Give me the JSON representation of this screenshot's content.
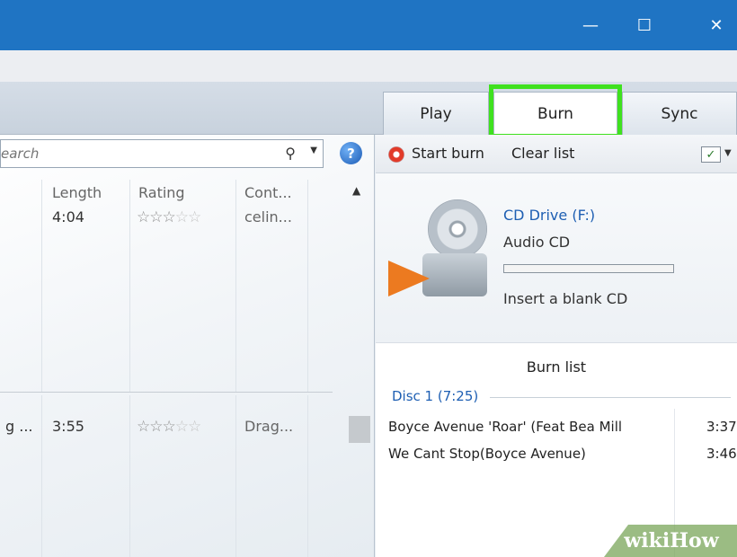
{
  "window": {
    "controls": {
      "minimize": "—",
      "maximize": "☐",
      "close": "✕"
    }
  },
  "tabs": [
    {
      "label": "Play",
      "active": false
    },
    {
      "label": "Burn",
      "active": true
    },
    {
      "label": "Sync",
      "active": false
    }
  ],
  "search": {
    "value": "",
    "placeholder": "earch"
  },
  "library": {
    "columns": [
      "Length",
      "Rating",
      "Cont..."
    ],
    "rows": [
      {
        "title": "",
        "length": "4:04",
        "rating": 3,
        "contributing": "celin..."
      },
      {
        "title": "g ...",
        "length": "3:55",
        "rating": 3,
        "contributing": "Drag..."
      }
    ]
  },
  "burn_toolbar": {
    "start_burn": "Start burn",
    "clear_list": "Clear list"
  },
  "drive": {
    "name": "CD Drive (F:)",
    "media": "Audio CD",
    "status": "Insert a blank CD",
    "progress": 0
  },
  "burn_list": {
    "title": "Burn list",
    "disc": "Disc 1 (7:25)",
    "tracks": [
      {
        "title": "Boyce Avenue  'Roar' (Feat Bea Mill",
        "time": "3:37"
      },
      {
        "title": "We Cant Stop(Boyce Avenue)",
        "time": "3:46"
      }
    ]
  },
  "watermark": "wikiHow",
  "colors": {
    "titlebar": "#1f74c3",
    "highlight": "#3fe11f",
    "link": "#1e5fb3"
  }
}
